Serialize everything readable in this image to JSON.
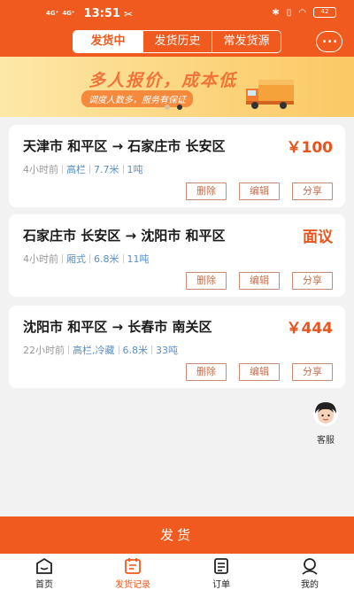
{
  "status_bar": {
    "net1": "4G⁺",
    "net2": "4G⁺",
    "time": "13:51",
    "battery": "42"
  },
  "tabs": [
    {
      "label": "发货中",
      "active": true
    },
    {
      "label": "发货历史",
      "active": false
    },
    {
      "label": "常发货源",
      "active": false
    }
  ],
  "banner": {
    "title": "多人报价，成本低",
    "subtitle": "调度人数多，服务有保证"
  },
  "cards": [
    {
      "route": "天津市 和平区 → 石家庄市 长安区",
      "price": "￥100",
      "time": "4小时前",
      "specs": [
        "高栏",
        "7.7米",
        "1吨"
      ]
    },
    {
      "route": "石家庄市 长安区 → 沈阳市 和平区",
      "price": "面议",
      "time": "4小时前",
      "specs": [
        "厢式",
        "6.8米",
        "11吨"
      ]
    },
    {
      "route": "沈阳市 和平区 → 长春市 南关区",
      "price": "￥444",
      "time": "22小时前",
      "specs": [
        "高栏,冷藏",
        "6.8米",
        "33吨"
      ]
    }
  ],
  "card_actions": {
    "delete": "删除",
    "edit": "编辑",
    "share": "分享"
  },
  "service": {
    "label": "客服"
  },
  "ship_button": "发货",
  "nav": [
    {
      "label": "首页",
      "icon": "home-icon"
    },
    {
      "label": "发货记录",
      "icon": "records-icon",
      "active": true
    },
    {
      "label": "订单",
      "icon": "orders-icon"
    },
    {
      "label": "我的",
      "icon": "profile-icon"
    }
  ],
  "colors": {
    "accent": "#f05a1e",
    "price": "#e8541c",
    "spec": "#5b8fc5"
  }
}
